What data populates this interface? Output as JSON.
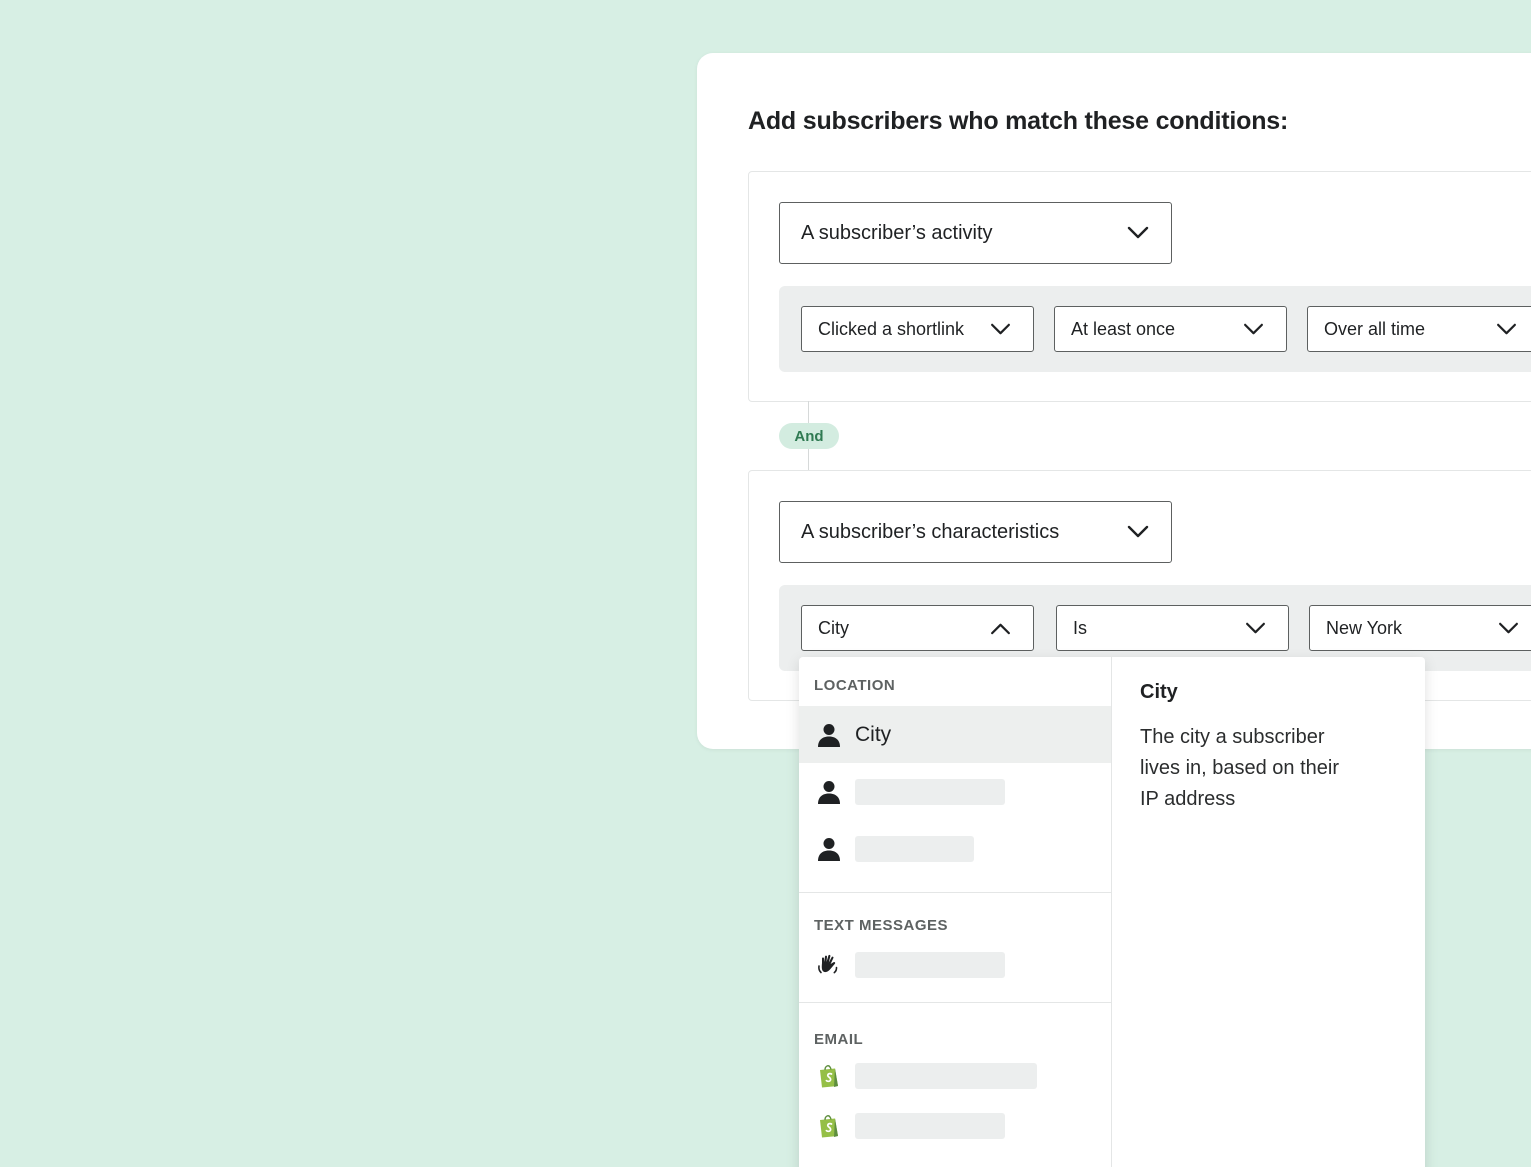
{
  "card": {
    "title": "Add subscribers who match these conditions:"
  },
  "group1": {
    "category": "A subscriber’s activity",
    "filters": [
      "Clicked a shortlink",
      "At least once",
      "Over all time"
    ]
  },
  "connector": {
    "label": "And"
  },
  "group2": {
    "category": "A subscriber’s characteristics",
    "filters": [
      "City",
      "Is",
      "New York"
    ]
  },
  "dropdown": {
    "sections": [
      {
        "heading": "LOCATION",
        "items": [
          {
            "label": "City",
            "icon": "person-icon",
            "selected": true
          },
          {
            "label": "",
            "icon": "person-icon"
          },
          {
            "label": "",
            "icon": "person-icon"
          }
        ]
      },
      {
        "heading": "TEXT MESSAGES",
        "items": [
          {
            "label": "",
            "icon": "hand-wave-icon"
          }
        ]
      },
      {
        "heading": "EMAIL",
        "items": [
          {
            "label": "",
            "icon": "shopify-bag-icon"
          },
          {
            "label": "",
            "icon": "shopify-bag-icon"
          }
        ]
      }
    ],
    "detail": {
      "title": "City",
      "description": "The city a subscriber lives in, based on their IP address"
    }
  },
  "colors": {
    "background": "#d7efe4",
    "and_pill_bg": "#d3ece0",
    "and_pill_text": "#2f7a52",
    "shopify_green": "#95bf47"
  }
}
